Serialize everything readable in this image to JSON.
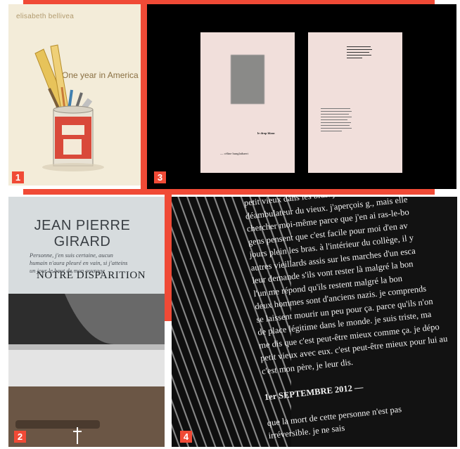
{
  "panel1": {
    "number": "1",
    "author": "elisabeth bellivea",
    "title": "One year in America"
  },
  "panel2": {
    "number": "2",
    "author_name": "JEAN PIERRE GIRARD",
    "quote": "Personne, j'en suis certaine, aucun humain n'aura pleuré en vain, si j'atteins un jour le bout de mon ouvrage",
    "book_title": "NOTRE DISPARITION"
  },
  "panel3": {
    "number": "3",
    "front_title": "le drop blanc",
    "front_author": "— céline hunglathaert"
  },
  "panel4": {
    "number": "4",
    "lines": [
      "petit vieux dans les bras. j'arrive del",
      "déambulateur du vieux. j'aperçois g., mais elle",
      "chercher moi-même parce que j'en ai ras-le-bo",
      "gens pensent que c'est facile pour moi d'en av",
      "jours plein les bras. à l'intérieur du collège, il y",
      "autres vieillards assis sur les marches d'un esca",
      "leur demande s'ils vont rester là malgré la bon",
      "l'un me répond qu'ils restent malgré la bon",
      "deux hommes sont d'anciens nazis. je comprends",
      "se laissent mourir un peu pour ça. parce qu'ils n'on",
      "de place légitime dans le monde. je suis triste, ma",
      "me dis que c'est peut-être mieux comme ça. je dépo",
      "petit vieux avec eux. c'est peut-être mieux pour lui au",
      "c'est mon père, je leur dis.",
      "",
      "1er SEPTEMBRE 2012 —",
      "",
      "que la mort de cette personne n'est pas",
      "irréversible. je ne sais"
    ]
  },
  "colors": {
    "accent_red": "#f04a36"
  }
}
